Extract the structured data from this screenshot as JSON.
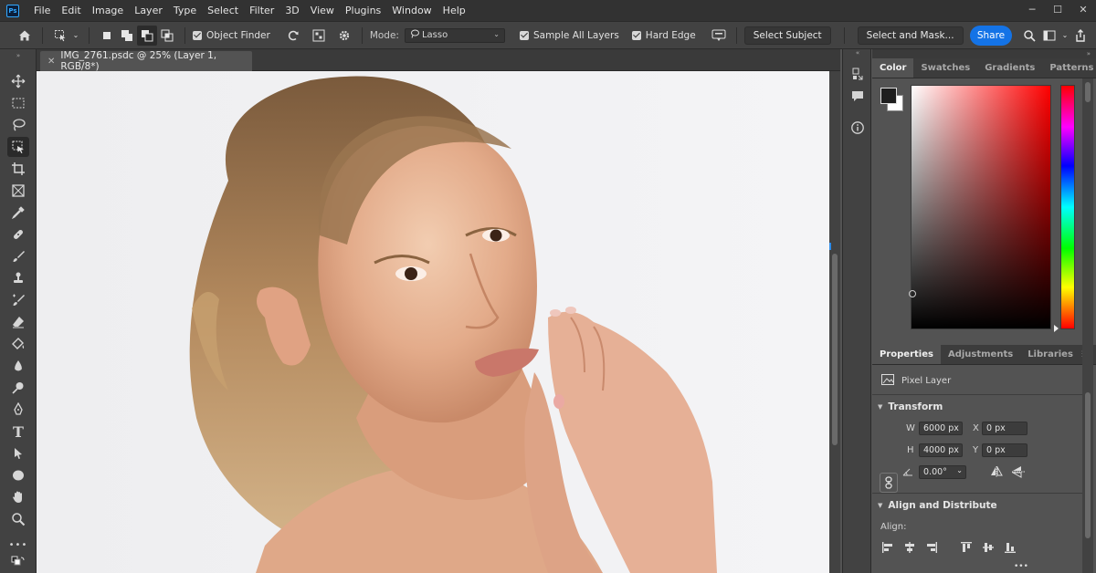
{
  "app": {
    "logo_text": "Ps",
    "menu": [
      "File",
      "Edit",
      "Image",
      "Layer",
      "Type",
      "Select",
      "Filter",
      "3D",
      "View",
      "Plugins",
      "Window",
      "Help"
    ]
  },
  "window_controls": {
    "minimize": "─",
    "maximize": "☐",
    "close": "✕"
  },
  "options_bar": {
    "object_finder": "Object Finder",
    "mode_label": "Mode:",
    "mode_value": "Lasso",
    "sample_all_layers": "Sample All Layers",
    "hard_edge": "Hard Edge",
    "select_subject": "Select Subject",
    "select_and_mask": "Select and Mask...",
    "share": "Share"
  },
  "document": {
    "tab_title": "IMG_2761.psdc @ 25% (Layer 1, RGB/8*)",
    "close_glyph": "✕"
  },
  "color_panel": {
    "tabs": [
      "Color",
      "Swatches",
      "Gradients",
      "Patterns"
    ],
    "foreground": "#1e1e1e",
    "background": "#ffffff",
    "hue": "#ff0000"
  },
  "properties_panel": {
    "tabs": [
      "Properties",
      "Adjustments",
      "Libraries"
    ],
    "layer_type": "Pixel Layer",
    "transform_title": "Transform",
    "w_label": "W",
    "w_value": "6000 px",
    "h_label": "H",
    "h_value": "4000 px",
    "x_label": "X",
    "x_value": "0 px",
    "y_label": "Y",
    "y_value": "0 px",
    "angle_value": "0.00°",
    "align_title": "Align and Distribute",
    "align_label": "Align:",
    "more": "•••"
  },
  "colors": {
    "accent": "#1473e6",
    "panel": "#535353",
    "chrome": "#424242"
  }
}
